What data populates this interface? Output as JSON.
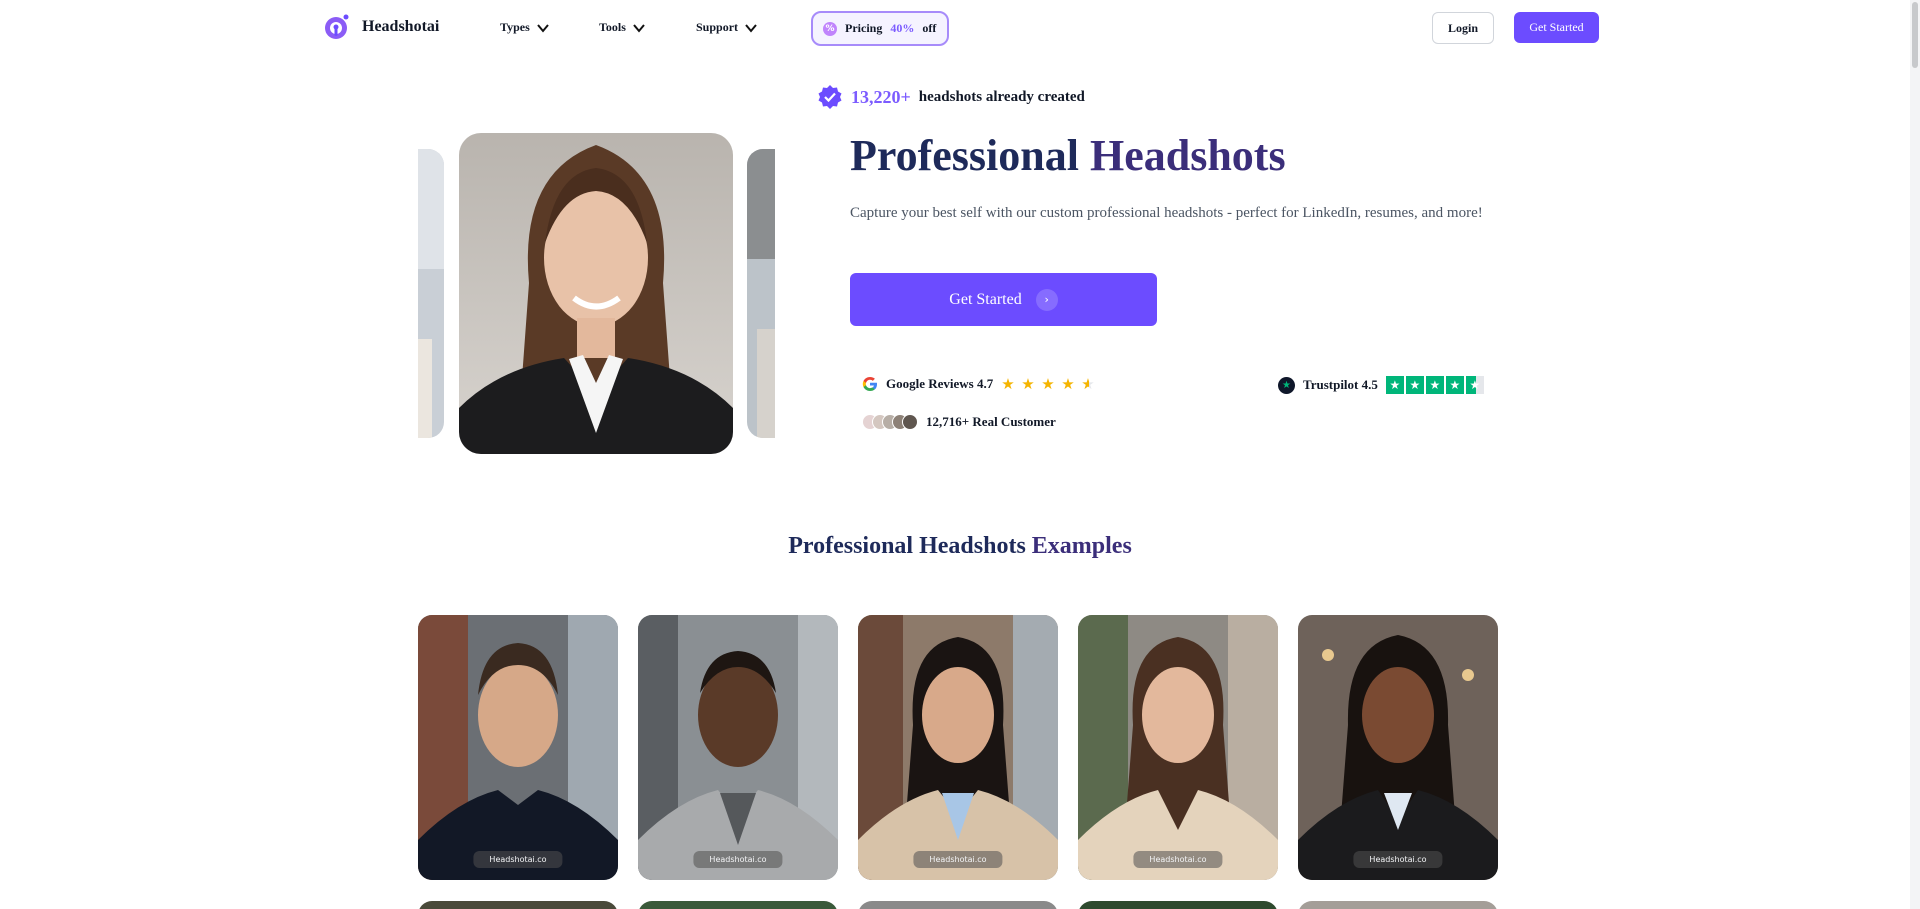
{
  "header": {
    "brand": "Headshotai",
    "nav": [
      "Types",
      "Tools",
      "Support"
    ],
    "pricing": {
      "label": "Pricing",
      "discount": "40%",
      "suffix": "off"
    },
    "login": "Login",
    "get_started": "Get Started"
  },
  "hero": {
    "count": "13,220+",
    "count_suffix": "headshots already created",
    "title_part1": "Professional",
    "title_part2": "Headshots",
    "subtitle": "Capture your best self with our custom professional headshots - perfect for LinkedIn, resumes, and more!",
    "cta": "Get Started",
    "google_label": "Google Reviews 4.7",
    "google_rating": 4.7,
    "trustpilot_label": "Trustpilot 4.5",
    "trustpilot_rating": 4.5,
    "customers": "12,716+ Real Customer"
  },
  "examples": {
    "title_part1": "Professional Headshots",
    "title_part2": "Examples",
    "watermark": "Headshotai.co",
    "cards": [
      {
        "name": "man-dark-shirt"
      },
      {
        "name": "man-grey-blazer"
      },
      {
        "name": "woman-beige-blazer"
      },
      {
        "name": "woman-cream-blazer"
      },
      {
        "name": "woman-black-blazer"
      }
    ]
  },
  "colors": {
    "accent": "#6c4cff",
    "title": "#1e2a5a",
    "star": "#f5b400",
    "trustpilot": "#00b67a"
  }
}
